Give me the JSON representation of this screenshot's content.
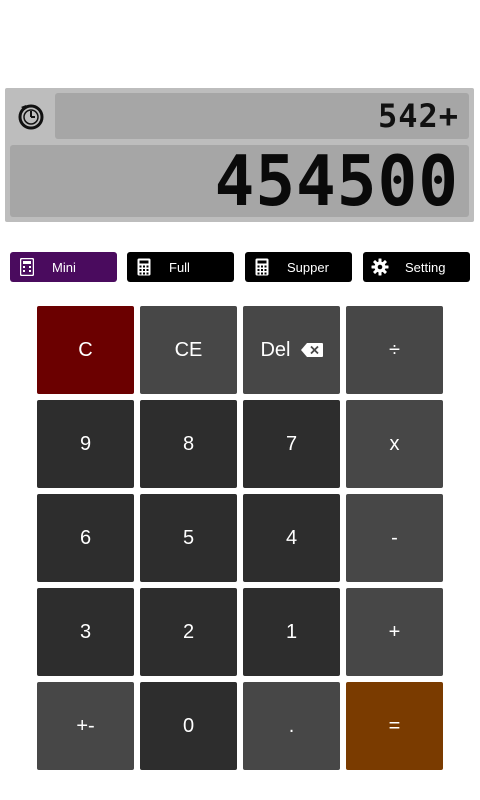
{
  "display": {
    "history_icon": "history-timer-icon",
    "expression": "542+",
    "result": "454500"
  },
  "tabs": [
    {
      "label": "Mini",
      "icon": "mini-calculator-icon",
      "active": true
    },
    {
      "label": "Full",
      "icon": "calculator-icon",
      "active": false
    },
    {
      "label": "Supper",
      "icon": "calculator-icon",
      "active": false
    },
    {
      "label": "Setting",
      "icon": "gear-icon",
      "active": false
    }
  ],
  "keys": {
    "clear": "C",
    "clear_entry": "CE",
    "delete": "Del",
    "divide": "÷",
    "nine": "9",
    "eight": "8",
    "seven": "7",
    "multiply": "x",
    "six": "6",
    "five": "5",
    "four": "4",
    "minus": "-",
    "three": "3",
    "two": "2",
    "one": "1",
    "plus": "+",
    "negate": "+-",
    "zero": "0",
    "decimal": ".",
    "equals": "="
  },
  "colors": {
    "active_tab": "#4a0b5e",
    "tab": "#000000",
    "clear_key": "#6b0000",
    "equals_key": "#7a3b00",
    "digit_key": "#2d2d2d",
    "operator_key": "#474747",
    "display_panel": "#a6a6a6"
  }
}
